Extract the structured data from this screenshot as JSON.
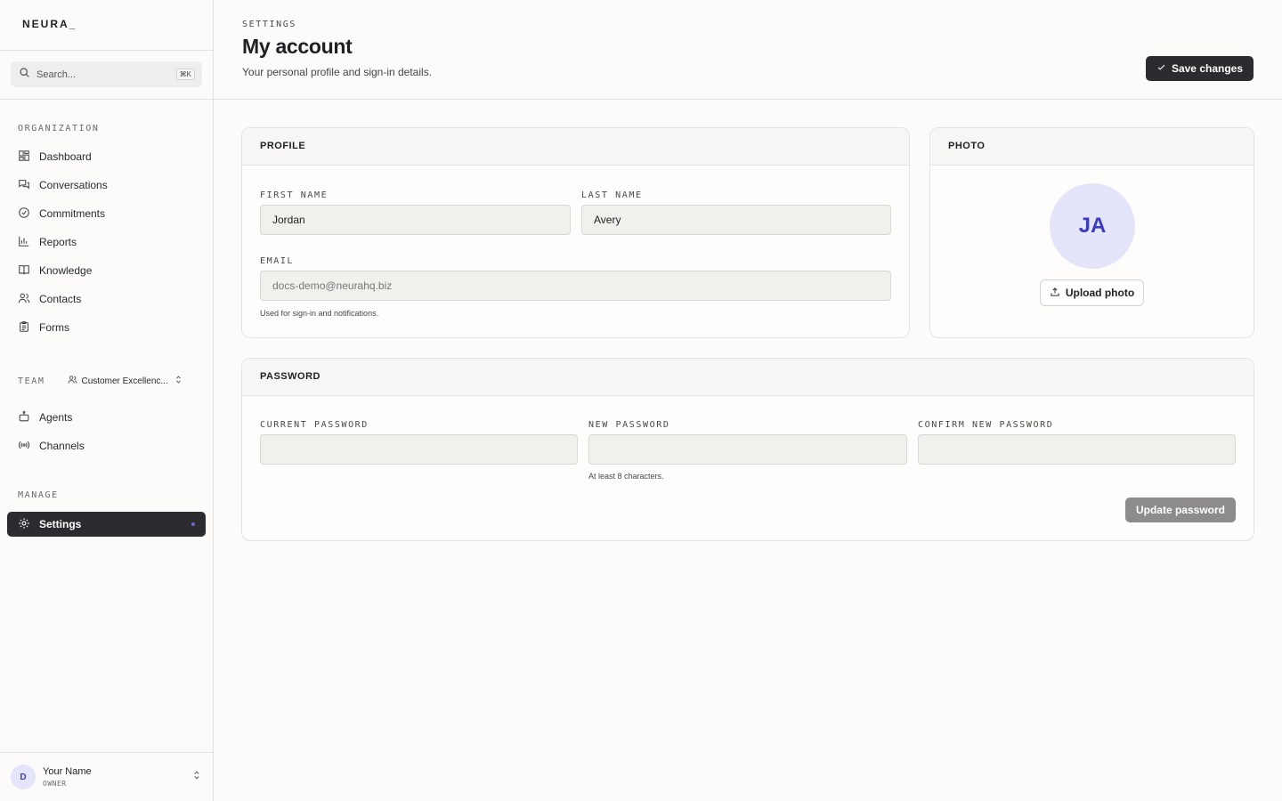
{
  "brand": "NEURA_",
  "search": {
    "placeholder": "Search...",
    "shortcut": "⌘K"
  },
  "sidebar": {
    "organization_label": "ORGANIZATION",
    "org_items": [
      {
        "label": "Dashboard",
        "icon": "dashboard-icon"
      },
      {
        "label": "Conversations",
        "icon": "conversations-icon"
      },
      {
        "label": "Commitments",
        "icon": "commitments-icon"
      },
      {
        "label": "Reports",
        "icon": "reports-icon"
      },
      {
        "label": "Knowledge",
        "icon": "knowledge-icon"
      },
      {
        "label": "Contacts",
        "icon": "contacts-icon"
      },
      {
        "label": "Forms",
        "icon": "forms-icon"
      }
    ],
    "team_label": "TEAM",
    "team_selected": "Customer Excellenc...",
    "team_items": [
      {
        "label": "Agents",
        "icon": "agents-icon"
      },
      {
        "label": "Channels",
        "icon": "channels-icon"
      }
    ],
    "manage_label": "MANAGE",
    "manage_items": [
      {
        "label": "Settings",
        "icon": "settings-icon",
        "active": true
      }
    ]
  },
  "user": {
    "initial": "D",
    "name": "Your Name",
    "role": "OWNER"
  },
  "header": {
    "eyebrow": "SETTINGS",
    "title": "My account",
    "subtitle": "Your personal profile and sign-in details.",
    "save_label": "Save changes"
  },
  "profile": {
    "heading": "PROFILE",
    "first_name_label": "FIRST NAME",
    "first_name": "Jordan",
    "last_name_label": "LAST NAME",
    "last_name": "Avery",
    "email_label": "EMAIL",
    "email": "docs-demo@neurahq.biz",
    "email_hint": "Used for sign-in and notifications."
  },
  "photo": {
    "heading": "PHOTO",
    "initials": "JA",
    "upload_label": "Upload photo"
  },
  "password": {
    "heading": "PASSWORD",
    "current_label": "CURRENT PASSWORD",
    "new_label": "NEW PASSWORD",
    "confirm_label": "CONFIRM NEW PASSWORD",
    "new_hint": "At least 8 characters.",
    "update_label": "Update password"
  },
  "colors": {
    "accent": "#2b2b30",
    "avatar_bg": "#e4e5fb",
    "avatar_text": "#3b3bc4"
  }
}
